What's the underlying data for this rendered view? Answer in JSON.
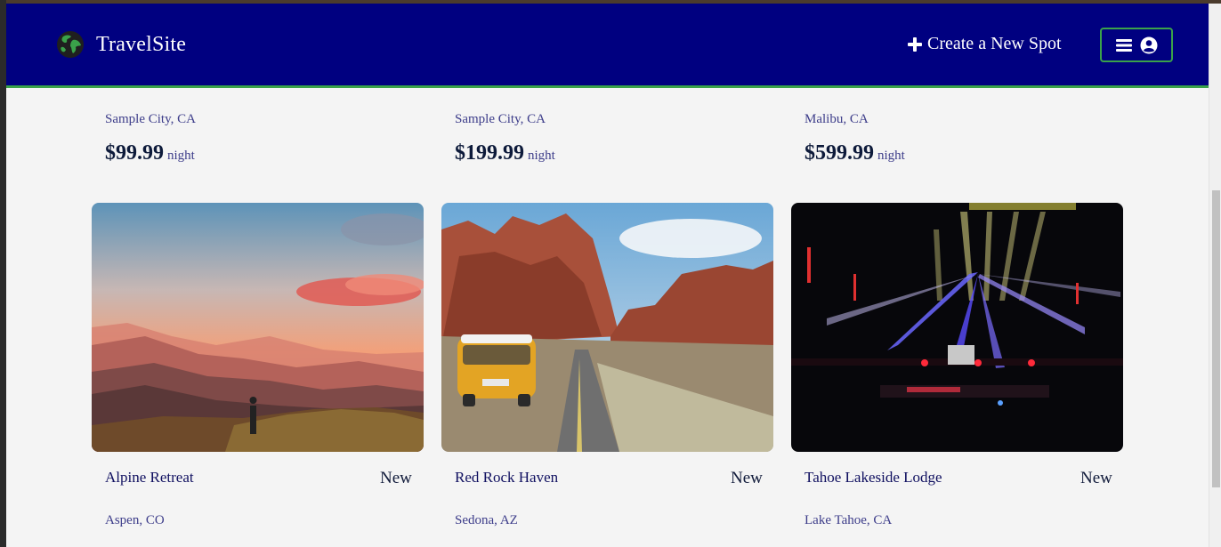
{
  "header": {
    "site_name": "TravelSite",
    "create_spot_label": "Create a New Spot",
    "brand_color": "#000080",
    "accent_color": "#3aa24a"
  },
  "top_row": [
    {
      "location": "Sample City, CA",
      "price": "$99.99",
      "per": "night"
    },
    {
      "location": "Sample City, CA",
      "price": "$199.99",
      "per": "night"
    },
    {
      "location": "Malibu, CA",
      "price": "$599.99",
      "per": "night"
    }
  ],
  "spots": [
    {
      "name": "Alpine Retreat",
      "rating": "New",
      "location": "Aspen, CO",
      "image": "mountain sunset hiker"
    },
    {
      "name": "Red Rock Haven",
      "rating": "New",
      "location": "Sedona, AZ",
      "image": "red rock desert road with van"
    },
    {
      "name": "Tahoe Lakeside Lodge",
      "rating": "New",
      "location": "Lake Tahoe, CA",
      "image": "concert stage lights"
    }
  ]
}
